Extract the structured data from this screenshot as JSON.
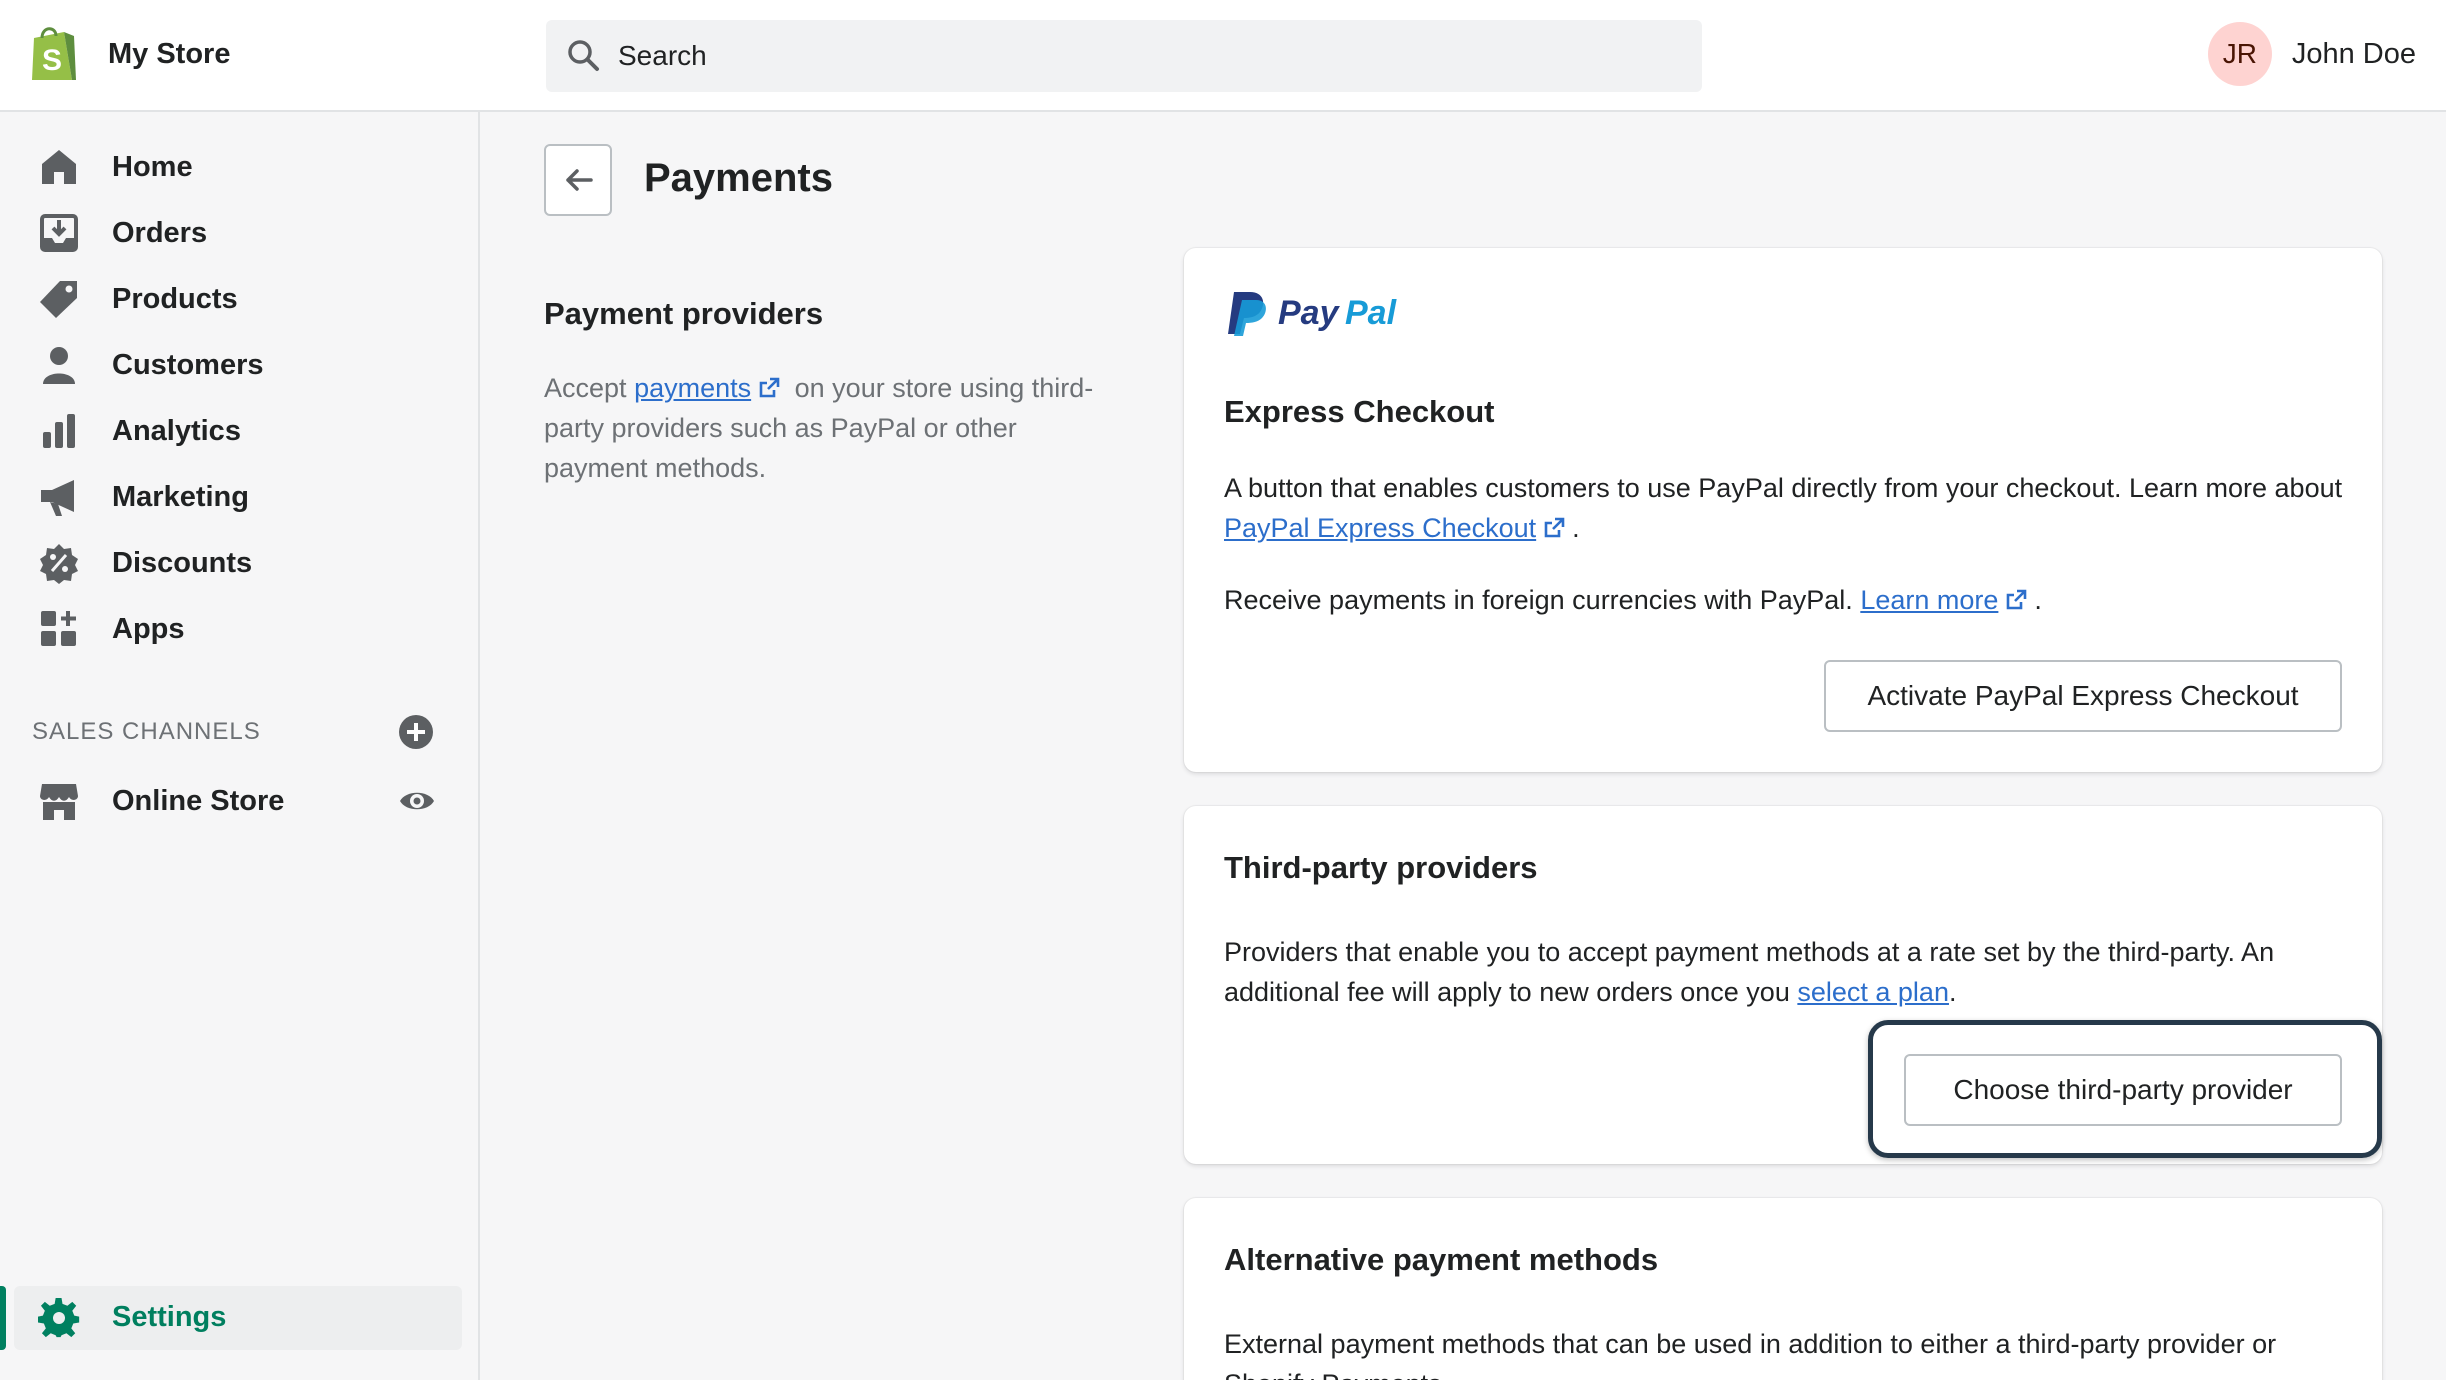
{
  "topbar": {
    "store_name": "My Store",
    "search_placeholder": "Search",
    "user_initials": "JR",
    "user_name": "John Doe"
  },
  "sidebar": {
    "items": [
      {
        "label": "Home",
        "icon": "home-icon"
      },
      {
        "label": "Orders",
        "icon": "orders-icon"
      },
      {
        "label": "Products",
        "icon": "tag-icon"
      },
      {
        "label": "Customers",
        "icon": "person-icon"
      },
      {
        "label": "Analytics",
        "icon": "bar-chart-icon"
      },
      {
        "label": "Marketing",
        "icon": "megaphone-icon"
      },
      {
        "label": "Discounts",
        "icon": "discount-icon"
      },
      {
        "label": "Apps",
        "icon": "apps-icon"
      }
    ],
    "channels_header": "SALES CHANNELS",
    "online_store": "Online Store",
    "settings": "Settings"
  },
  "page": {
    "title": "Payments",
    "section_title": "Payment providers",
    "section_desc_prefix": "Accept",
    "section_desc_link": "payments",
    "section_desc_suffix": "on your store using third-party providers such as PayPal or other payment methods."
  },
  "paypal_card": {
    "logo_text_1": "Pay",
    "logo_text_2": "Pal",
    "title": "Express Checkout",
    "text1_prefix": "A button that enables customers to use PayPal directly from your checkout. Learn more about",
    "text1_link": "PayPal Express Checkout",
    "text1_suffix": ".",
    "text2_prefix": "Receive payments in foreign currencies with PayPal.",
    "text2_link": "Learn more",
    "text2_suffix": ".",
    "button": "Activate PayPal Express Checkout"
  },
  "third_party_card": {
    "title": "Third-party providers",
    "text_prefix": "Providers that enable you to accept payment methods at a rate set by the third-party. An additional fee will apply to new orders once you",
    "text_link": "select a plan",
    "text_suffix": ".",
    "button": "Choose third-party provider"
  },
  "alt_card": {
    "title": "Alternative payment methods",
    "text": "External payment methods that can be used in addition to either a third-party provider or Shopify Payments."
  },
  "colors": {
    "accent_green": "#008060",
    "link_blue": "#2c6ecb",
    "paypal_dark": "#253b80",
    "paypal_light": "#179bd7"
  }
}
